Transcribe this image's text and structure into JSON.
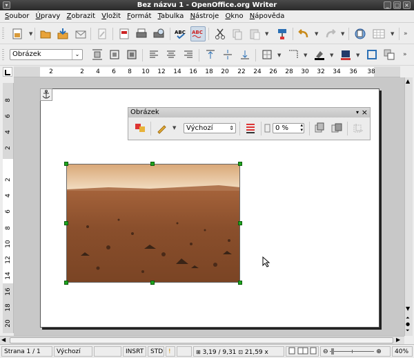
{
  "window": {
    "title": "Bez názvu 1 - OpenOffice.org Writer"
  },
  "menu": [
    {
      "u": "S",
      "rest": "oubor"
    },
    {
      "u": "Ú",
      "rest": "pravy"
    },
    {
      "u": "Z",
      "rest": "obrazit"
    },
    {
      "u": "V",
      "rest": "ložit"
    },
    {
      "u": "F",
      "rest": "ormát"
    },
    {
      "u": "T",
      "rest": "abulka"
    },
    {
      "u": "N",
      "rest": "ástroje"
    },
    {
      "u": "O",
      "rest": "kno"
    },
    {
      "u": "N",
      "rest": "ápověda"
    }
  ],
  "format_toolbar": {
    "style_value": "Obrázek"
  },
  "ruler": {
    "h_numbers": [
      "2",
      "2",
      "4",
      "6",
      "8",
      "10",
      "12",
      "14",
      "16",
      "18",
      "20",
      "22",
      "24",
      "26",
      "28",
      "30",
      "32",
      "34",
      "36",
      "38"
    ],
    "v_numbers": [
      "8",
      "6",
      "4",
      "2",
      "2",
      "4",
      "6",
      "8",
      "10",
      "12",
      "14",
      "16",
      "18",
      "20"
    ]
  },
  "image_toolbar": {
    "title": "Obrázek",
    "mode_value": "Výchozí",
    "transparency_value": "0 %"
  },
  "status": {
    "page": "Strana 1 / 1",
    "style": "Výchozí",
    "insert_mode": "INSRT",
    "selection_mode": "STD",
    "position": "3,19 / 9,31",
    "size": "21,59 x",
    "zoom": "40%"
  },
  "colors": {
    "handle": "#1ea51e",
    "title_bar": "#333333",
    "pressed": "#cfdbe8"
  }
}
